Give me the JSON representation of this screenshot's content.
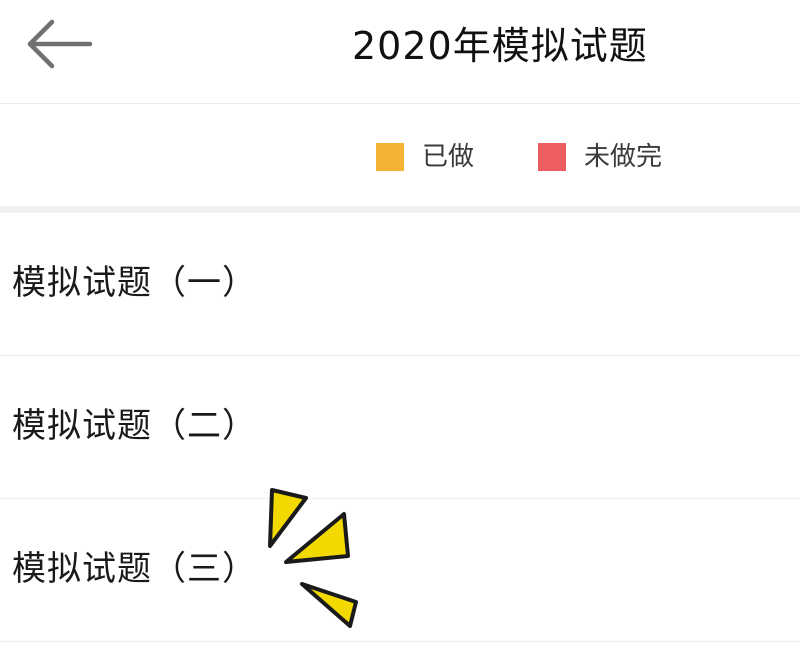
{
  "header": {
    "title": "2020年模拟试题",
    "back_icon": "arrow-left-icon"
  },
  "legend": {
    "items": [
      {
        "label": "已做",
        "color": "#F5B335"
      },
      {
        "label": "未做完",
        "color": "#EE5E5E"
      }
    ]
  },
  "exams": [
    {
      "label": "模拟试题（一）"
    },
    {
      "label": "模拟试题（二）"
    },
    {
      "label": "模拟试题（三）"
    }
  ],
  "decoration": {
    "sparkle_color": "#F2D900",
    "sparkle_icon": "sparkle-burst-icon"
  }
}
